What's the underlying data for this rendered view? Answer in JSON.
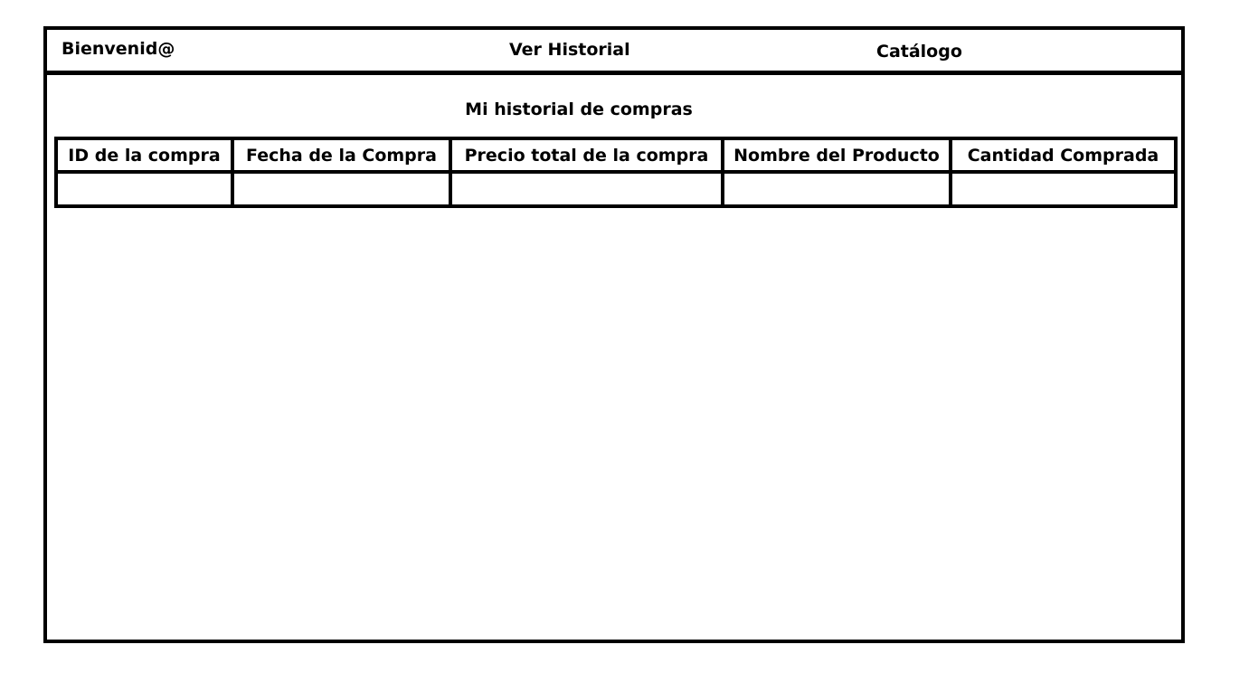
{
  "header": {
    "welcome": "Bienvenid@",
    "history_link": "Ver Historial",
    "catalog_link": "Catálogo"
  },
  "main": {
    "title": "Mi historial de compras",
    "table": {
      "columns": [
        "ID de la compra",
        "Fecha de la Compra",
        "Precio total de la compra",
        "Nombre del Producto",
        "Cantidad Comprada"
      ],
      "rows": [
        [
          "",
          "",
          "",
          "",
          ""
        ]
      ]
    }
  }
}
